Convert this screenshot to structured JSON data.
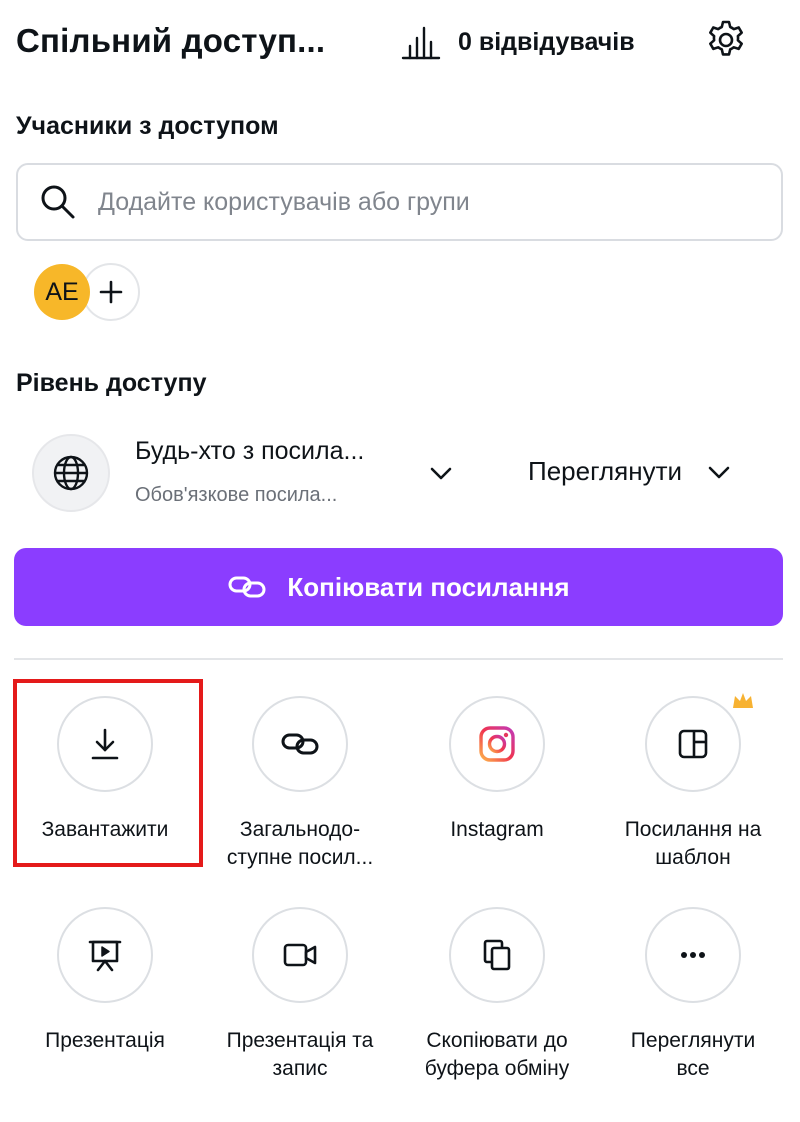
{
  "header": {
    "title": "Спільний доступ...",
    "visitors_label": "0 відвідувачів"
  },
  "people": {
    "label": "Учасники з доступом",
    "search_placeholder": "Додайте користувачів або групи",
    "avatar_initials": "AE",
    "add_symbol": "+"
  },
  "access": {
    "label": "Рівень доступу",
    "scope_title": "Будь-хто з посила...",
    "scope_subtitle": "Обов'язкове посила...",
    "permission": "Переглянути"
  },
  "copy_link_button": "Копіювати посилання",
  "share_options": [
    {
      "label": "Завантажити",
      "icon": "download-icon"
    },
    {
      "label": "Загальнодо-\nступне посил...",
      "icon": "link-icon"
    },
    {
      "label": "Instagram",
      "icon": "instagram-icon"
    },
    {
      "label": "Посилання на\nшаблон",
      "icon": "template-icon",
      "premium": true
    },
    {
      "label": "Презентація",
      "icon": "presentation-icon"
    },
    {
      "label": "Презентація та\nзапис",
      "icon": "video-camera-icon"
    },
    {
      "label": "Скопіювати до\nбуфера обміну",
      "icon": "copy-icon"
    },
    {
      "label": "Переглянути\nвсе",
      "icon": "more-icon"
    }
  ],
  "colors": {
    "accent": "#8b3dff",
    "avatar": "#f7b729",
    "highlight": "#e41a1a"
  }
}
